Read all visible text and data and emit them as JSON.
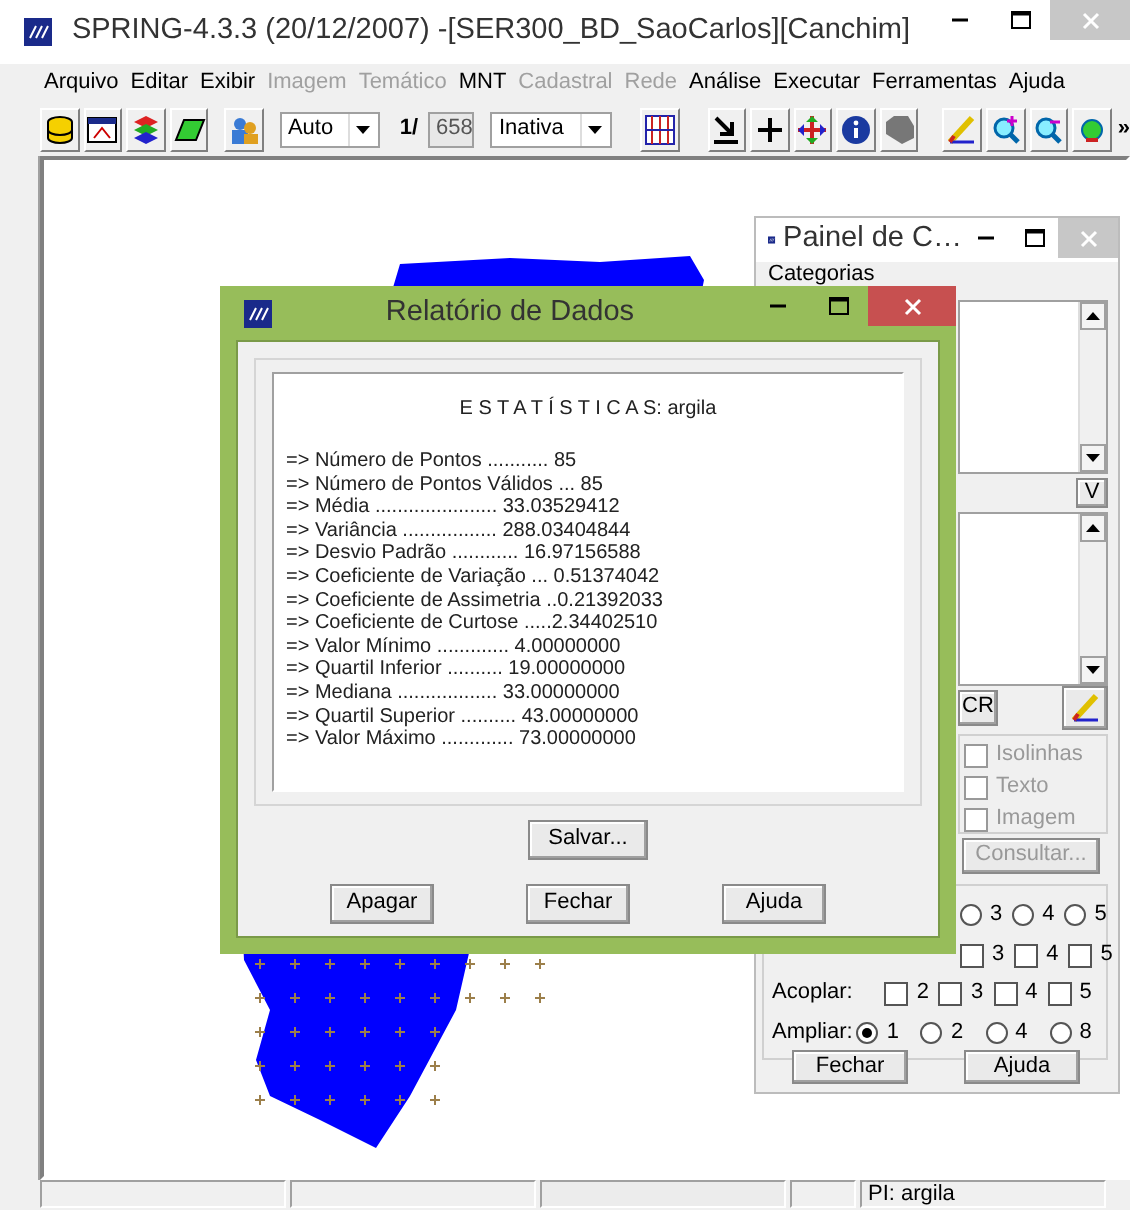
{
  "main_window": {
    "title": "SPRING-4.3.3 (20/12/2007) -[SER300_BD_SaoCarlos][Canchim]"
  },
  "menu": [
    {
      "label": "Arquivo",
      "disabled": false
    },
    {
      "label": "Editar",
      "disabled": false
    },
    {
      "label": "Exibir",
      "disabled": false
    },
    {
      "label": "Imagem",
      "disabled": true
    },
    {
      "label": "Temático",
      "disabled": true
    },
    {
      "label": "MNT",
      "disabled": false
    },
    {
      "label": "Cadastral",
      "disabled": true
    },
    {
      "label": "Rede",
      "disabled": true
    },
    {
      "label": "Análise",
      "disabled": false
    },
    {
      "label": "Executar",
      "disabled": false
    },
    {
      "label": "Ferramentas",
      "disabled": false
    },
    {
      "label": "Ajuda",
      "disabled": false
    }
  ],
  "toolbar": {
    "scale_mode": "Auto",
    "scale_prefix": "1/",
    "scale_value": "658",
    "edit_mode": "Inativa",
    "overflow": "»"
  },
  "report_dialog": {
    "title": "Relatório de Dados",
    "heading": "E S T A T Í S T I C A S: argila",
    "lines": [
      "=> Número de Pontos ........... 85",
      "=> Número de Pontos Válidos ... 85",
      "=> Média ...................... 33.03529412",
      "=> Variância ................. 288.03404844",
      "=> Desvio Padrão ............ 16.97156588",
      "=> Coeficiente de Variação ... 0.51374042",
      "=> Coeficiente de Assimetria ..0.21392033",
      "=> Coeficiente de Curtose .....2.34402510",
      "=> Valor Mínimo ............. 4.00000000",
      "=> Quartil Inferior .......... 19.00000000",
      "=> Mediana .................. 33.00000000",
      "=> Quartil Superior .......... 43.00000000",
      "=> Valor Máximo ............. 73.00000000"
    ],
    "save_button": "Salvar...",
    "buttons": [
      "Apagar",
      "Fechar",
      "Ajuda"
    ]
  },
  "control_panel": {
    "title": "Painel de C…",
    "categories_label": "Categorias",
    "v_button": "V",
    "cr_button": "CR",
    "checkboxes": [
      {
        "label": "Isolinhas",
        "checked": false,
        "disabled": true
      },
      {
        "label": "Texto",
        "checked": false,
        "disabled": true
      },
      {
        "label": "Imagem",
        "checked": false,
        "disabled": true
      }
    ],
    "consult_button": {
      "label": "Consultar...",
      "disabled": true
    },
    "radio_row": [
      {
        "label": "3",
        "selected": false
      },
      {
        "label": "4",
        "selected": false
      },
      {
        "label": "5",
        "selected": false
      }
    ],
    "check_row": [
      {
        "label": "3",
        "checked": false
      },
      {
        "label": "4",
        "checked": false
      },
      {
        "label": "5",
        "checked": false
      }
    ],
    "acoplar": {
      "label": "Acoplar:",
      "options": [
        {
          "label": "2",
          "checked": false
        },
        {
          "label": "3",
          "checked": false
        },
        {
          "label": "4",
          "checked": false
        },
        {
          "label": "5",
          "checked": false
        }
      ]
    },
    "ampliar": {
      "label": "Ampliar:",
      "options": [
        {
          "label": "1",
          "selected": true
        },
        {
          "label": "2",
          "selected": false
        },
        {
          "label": "4",
          "selected": false
        },
        {
          "label": "8",
          "selected": false
        }
      ]
    },
    "buttons": [
      "Fechar",
      "Ajuda"
    ]
  },
  "status_bar": {
    "plane": "PI: argila"
  }
}
